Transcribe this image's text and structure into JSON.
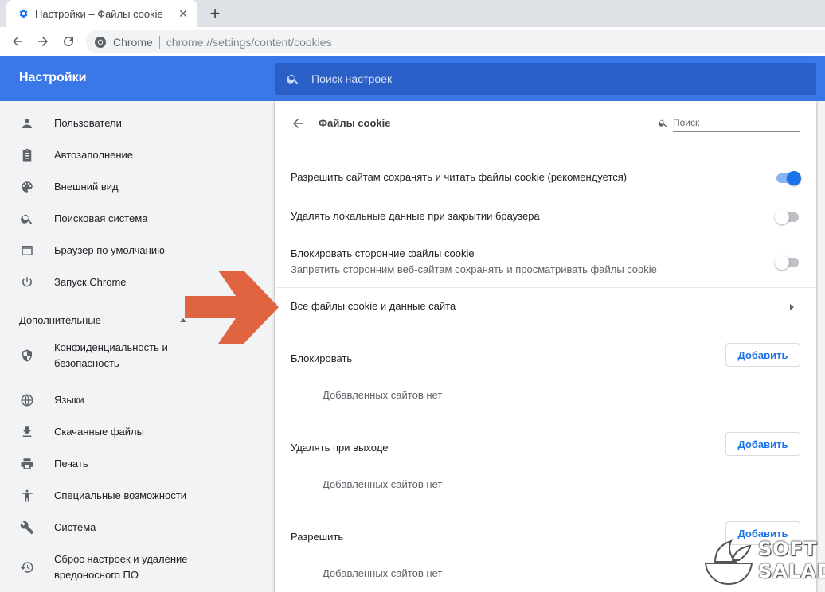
{
  "browser": {
    "tab_title": "Настройки – Файлы cookie",
    "tab_close": "✕",
    "new_tab": "+",
    "omnibox_chip": "Chrome",
    "url_scheme": "chrome://",
    "url_path": "settings/content/cookies"
  },
  "header": {
    "title": "Настройки",
    "search_placeholder": "Поиск настроек"
  },
  "sidebar": {
    "items": [
      {
        "label": "Пользователи",
        "icon": "person-icon"
      },
      {
        "label": "Автозаполнение",
        "icon": "clipboard-icon"
      },
      {
        "label": "Внешний вид",
        "icon": "palette-icon"
      },
      {
        "label": "Поисковая система",
        "icon": "search-icon"
      },
      {
        "label": "Браузер по умолчанию",
        "icon": "browser-window-icon"
      },
      {
        "label": "Запуск Chrome",
        "icon": "power-icon"
      }
    ],
    "advanced_label": "Дополнительные",
    "advanced_items": [
      {
        "label": "Конфиденциальность и безопасность",
        "icon": "shield-icon"
      },
      {
        "label": "Языки",
        "icon": "globe-icon"
      },
      {
        "label": "Скачанные файлы",
        "icon": "download-icon"
      },
      {
        "label": "Печать",
        "icon": "printer-icon"
      },
      {
        "label": "Специальные возможности",
        "icon": "accessibility-icon"
      },
      {
        "label": "Система",
        "icon": "wrench-icon"
      },
      {
        "label": "Сброс настроек и удаление вредоносного ПО",
        "icon": "restore-icon"
      }
    ]
  },
  "main": {
    "title": "Файлы cookie",
    "search_placeholder": "Поиск",
    "settings": [
      {
        "label": "Разрешить сайтам сохранять и читать файлы cookie (рекомендуется)",
        "enabled": true
      },
      {
        "label": "Удалять локальные данные при закрытии браузера",
        "enabled": false
      },
      {
        "label": "Блокировать сторонние файлы cookie",
        "sublabel": "Запретить сторонним веб-сайтам сохранять и просматривать файлы cookie",
        "enabled": false
      }
    ],
    "all_cookies_link": "Все файлы cookie и данные сайта",
    "sections": [
      {
        "title": "Блокировать",
        "button": "Добавить",
        "empty": "Добавленных сайтов нет"
      },
      {
        "title": "Удалять при выходе",
        "button": "Добавить",
        "empty": "Добавленных сайтов нет"
      },
      {
        "title": "Разрешить",
        "button": "Добавить",
        "empty": "Добавленных сайтов нет"
      }
    ]
  },
  "watermark": {
    "line1": "SOFT",
    "line2": "SALAD"
  },
  "colors": {
    "header_blue": "#3b78e7",
    "search_blue": "#2a5fc7",
    "accent": "#1a73e8",
    "arrow": "#e0643f"
  }
}
